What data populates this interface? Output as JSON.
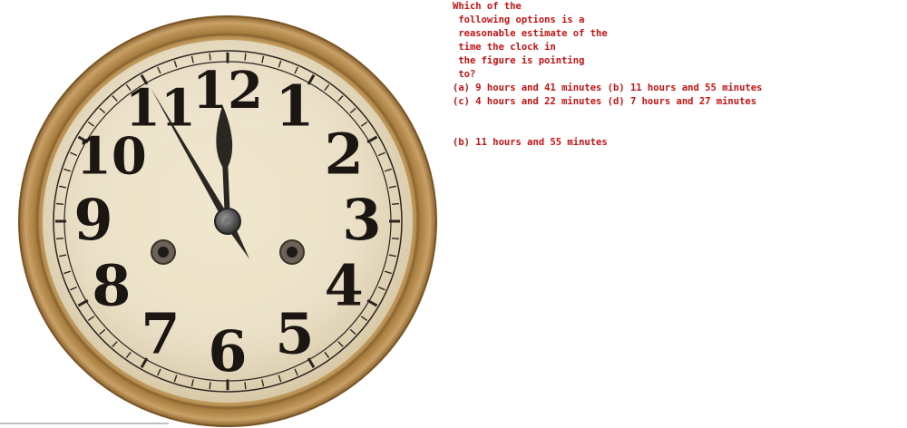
{
  "question": {
    "lines": [
      "Which of the",
      " following options is a",
      " reasonable estimate of the",
      " time the clock in",
      " the figure is pointing",
      " to?",
      "(a) 9 hours and 41 minutes (b) 11 hours and 55 minutes",
      "(c) 4 hours and 22 minutes (d) 7 hours and 27 minutes"
    ]
  },
  "answer": "(b) 11 hours and 55 minutes",
  "clock": {
    "numerals": [
      "12",
      "1",
      "2",
      "3",
      "4",
      "5",
      "6",
      "7",
      "8",
      "9",
      "10",
      "11"
    ],
    "time": {
      "hour": 11,
      "minute": 55
    },
    "colors": {
      "rim": "#b48a4e",
      "dial": "#efe6d2",
      "hands": "#2a2622"
    }
  }
}
